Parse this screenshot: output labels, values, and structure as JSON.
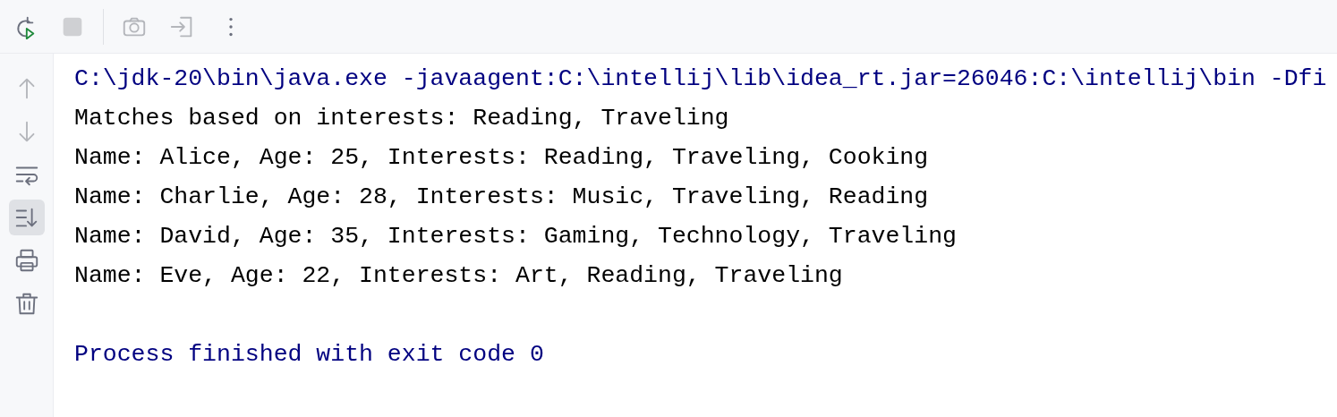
{
  "toolbar": [
    {
      "kind": "rerun",
      "disabled": false
    },
    {
      "kind": "stop",
      "disabled": true
    },
    {
      "kind": "divider"
    },
    {
      "kind": "camera",
      "disabled": true
    },
    {
      "kind": "exit",
      "disabled": true
    },
    {
      "kind": "more",
      "disabled": false
    }
  ],
  "sidebar": [
    {
      "kind": "up",
      "disabled": true,
      "on": false
    },
    {
      "kind": "down",
      "disabled": true,
      "on": false
    },
    {
      "kind": "wrap",
      "disabled": false,
      "on": false
    },
    {
      "kind": "scroll-end",
      "disabled": false,
      "on": true
    },
    {
      "kind": "print",
      "disabled": false,
      "on": false
    },
    {
      "kind": "trash",
      "disabled": false,
      "on": false
    }
  ],
  "console": [
    {
      "kind": "system",
      "text": "C:\\jdk-20\\bin\\java.exe -javaagent:C:\\intellij\\lib\\idea_rt.jar=26046:C:\\intellij\\bin -Dfi"
    },
    {
      "kind": "output",
      "text": "Matches based on interests: Reading, Traveling"
    },
    {
      "kind": "output",
      "text": "Name: Alice, Age: 25, Interests: Reading, Traveling, Cooking"
    },
    {
      "kind": "output",
      "text": "Name: Charlie, Age: 28, Interests: Music, Traveling, Reading"
    },
    {
      "kind": "output",
      "text": "Name: David, Age: 35, Interests: Gaming, Technology, Traveling"
    },
    {
      "kind": "output",
      "text": "Name: Eve, Age: 22, Interests: Art, Reading, Traveling"
    },
    {
      "kind": "blank"
    },
    {
      "kind": "system",
      "text": "Process finished with exit code 0"
    }
  ]
}
